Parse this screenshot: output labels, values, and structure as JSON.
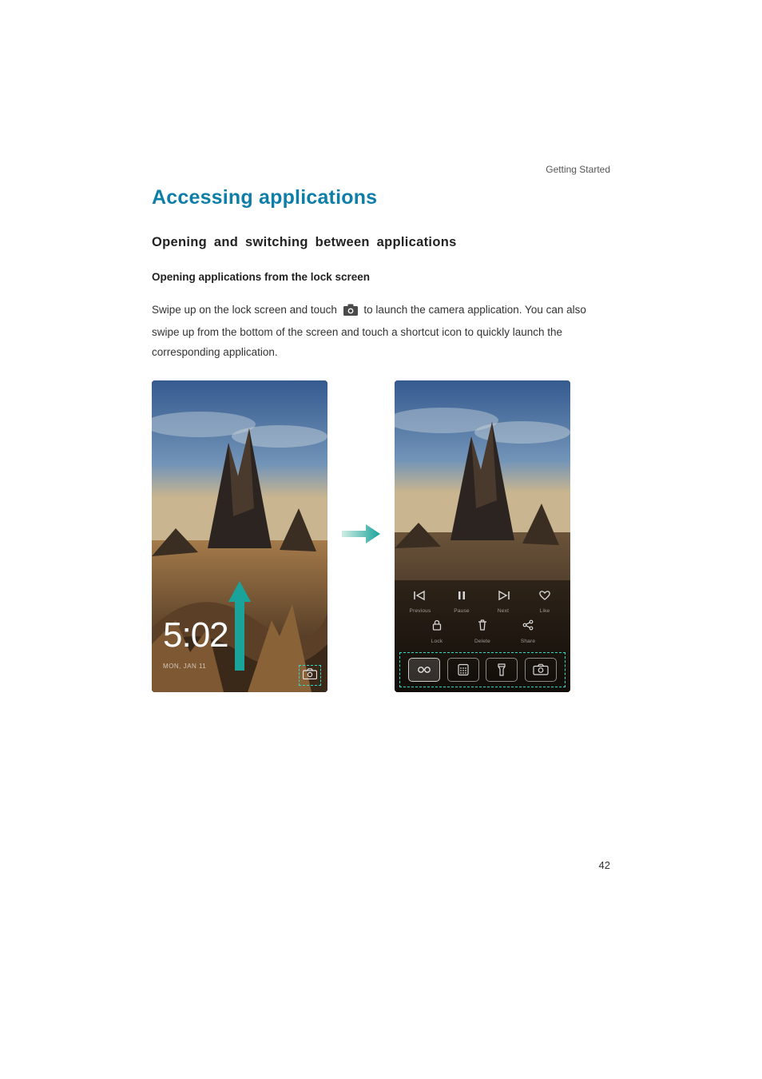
{
  "header": {
    "section": "Getting Started"
  },
  "h1": "Accessing applications",
  "h2": "Opening and switching between applications",
  "h3": "Opening applications from the lock screen",
  "para": {
    "pre": "Swipe up on the lock screen and touch ",
    "post": " to launch the camera application. You can also swipe up from the bottom of the screen and touch a shortcut icon to quickly launch the corresponding application."
  },
  "lockscreen": {
    "time": "5:02",
    "date": "MON, JAN 11"
  },
  "controls": {
    "row1": [
      {
        "icon": "skip-back",
        "label": "Previous"
      },
      {
        "icon": "pause",
        "label": "Pause"
      },
      {
        "icon": "skip-fwd",
        "label": "Next"
      },
      {
        "icon": "heart",
        "label": "Like"
      }
    ],
    "row2": [
      {
        "icon": "lock",
        "label": "Lock"
      },
      {
        "icon": "delete",
        "label": "Delete"
      },
      {
        "icon": "share",
        "label": "Share"
      }
    ]
  },
  "shortcuts": [
    {
      "icon": "recorder",
      "name": "recorder-shortcut"
    },
    {
      "icon": "calculator",
      "name": "calculator-shortcut"
    },
    {
      "icon": "flashlight",
      "name": "flashlight-shortcut"
    },
    {
      "icon": "camera",
      "name": "camera-shortcut"
    }
  ],
  "page_number": "42"
}
